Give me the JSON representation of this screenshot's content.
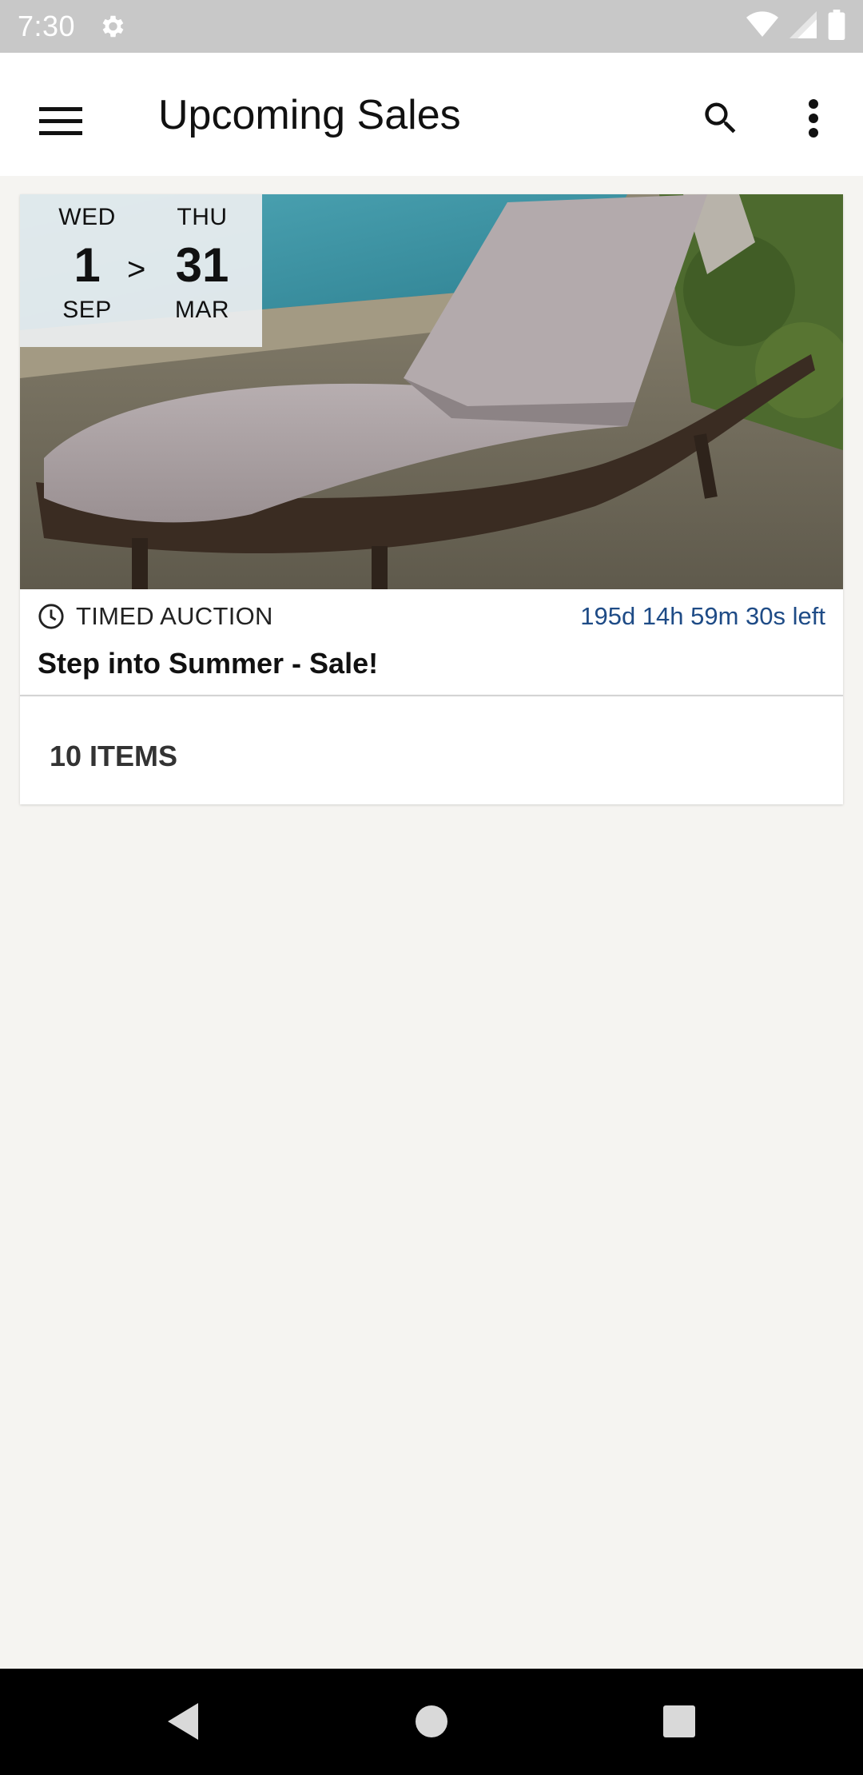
{
  "status_bar": {
    "time": "7:30"
  },
  "app_bar": {
    "title": "Upcoming Sales"
  },
  "sale": {
    "start": {
      "dow": "WED",
      "day": "1",
      "month": "SEP"
    },
    "arrow": ">",
    "end": {
      "dow": "THU",
      "day": "31",
      "month": "MAR"
    },
    "type": "TIMED AUCTION",
    "time_left": "195d 14h 59m 30s left",
    "title": "Step into Summer - Sale!",
    "items": "10 ITEMS"
  },
  "colors": {
    "background": "#f5f4f1",
    "time_left": "#1e4b86",
    "status_bar": "#c8c8c8"
  },
  "icons": [
    "gear-icon",
    "wifi-icon",
    "signal-icon",
    "battery-icon",
    "menu-icon",
    "search-icon",
    "more-vert-icon",
    "clock-icon",
    "back-icon",
    "home-icon",
    "recents-icon"
  ]
}
